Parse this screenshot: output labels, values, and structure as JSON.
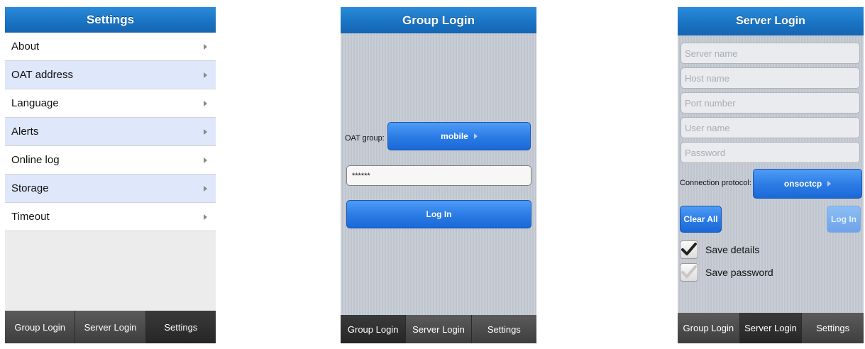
{
  "settings_screen": {
    "title": "Settings",
    "items": [
      {
        "label": "About"
      },
      {
        "label": "OAT address"
      },
      {
        "label": "Language"
      },
      {
        "label": "Alerts"
      },
      {
        "label": "Online log"
      },
      {
        "label": "Storage"
      },
      {
        "label": "Timeout"
      }
    ],
    "tabs": [
      "Group Login",
      "Server Login",
      "Settings"
    ],
    "active_tab": "Settings"
  },
  "group_login_screen": {
    "title": "Group Login",
    "oat_group_label": "OAT group:",
    "oat_group_value": "mobile",
    "password_value": "******",
    "login_button": "Log In",
    "tabs": [
      "Group Login",
      "Server Login",
      "Settings"
    ],
    "active_tab": "Group Login"
  },
  "server_login_screen": {
    "title": "Server Login",
    "fields": {
      "server_name_placeholder": "Server name",
      "host_name_placeholder": "Host name",
      "port_number_placeholder": "Port number",
      "user_name_placeholder": "User name",
      "password_placeholder": "Password"
    },
    "connection_protocol_label": "Connection protocol:",
    "connection_protocol_value": "onsoctcp",
    "clear_all_button": "Clear All",
    "login_button": "Log In",
    "save_details_label": "Save details",
    "save_details_checked": true,
    "save_password_label": "Save password",
    "save_password_checked": false,
    "tabs": [
      "Group Login",
      "Server Login",
      "Settings"
    ],
    "active_tab": "Server Login"
  },
  "colors": {
    "title_blue": "#1a74c4",
    "button_blue": "#2d7de6",
    "alt_row": "#dfe7fb",
    "tab_dark": "#3e3e3e"
  }
}
